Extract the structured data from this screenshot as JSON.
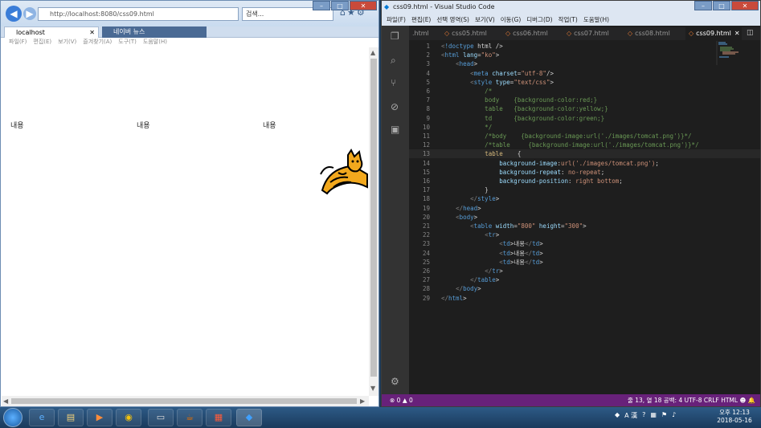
{
  "ie": {
    "address": "http://localhost:8080/css09.html",
    "search_placeholder": "검색...",
    "tab_active": "localhost",
    "tab_other": "네이버 뉴스",
    "menu": [
      "파일(F)",
      "편집(E)",
      "보기(V)",
      "즐겨찾기(A)",
      "도구(T)",
      "도움말(H)"
    ],
    "cells": [
      "내용",
      "내용",
      "내용"
    ]
  },
  "vscode": {
    "title": "css09.html - Visual Studio Code",
    "menu": [
      "파일(F)",
      "편집(E)",
      "선택 영역(S)",
      "보기(V)",
      "이동(G)",
      "디버그(D)",
      "작업(T)",
      "도움말(H)"
    ],
    "tabs": [
      ".html",
      "css05.html",
      "css06.html",
      "css07.html",
      "css08.html",
      "css09.html"
    ],
    "active_tab": "css09.html",
    "lines": [
      "<!doctype html />",
      "<html lang=\"ko\">",
      "    <head>",
      "        <meta charset=\"utf-8\"/>",
      "        <style type=\"text/css\">",
      "            /*",
      "            body    {background-color:red;}",
      "            table   {background-color:yellow;}",
      "            td      {background-color:green;}",
      "            */",
      "            /*body    {background-image:url('./images/tomcat.png')}*/",
      "            /*table     {background-image:url('./images/tomcat.png')}*/",
      "            table    {",
      "                background-image:url('./images/tomcat.png');",
      "                background-repeat: no-repeat;",
      "                background-position: right bottom;",
      "            }",
      "        </style>",
      "    </head>",
      "    <body>",
      "        <table width=\"800\" height=\"300\">",
      "            <tr>",
      "                <td>내용</td>",
      "                <td>내용</td>",
      "                <td>내용</td>",
      "            </tr>",
      "        </table>",
      "    </body>",
      "</html>"
    ],
    "status_left": "⊗ 0 ▲ 0",
    "status_right": "줄 13, 열 18   공백: 4   UTF-8   CRLF   HTML   ☻   🔔"
  },
  "taskbar": {
    "lang": "A 漢",
    "time": "오후 12:13",
    "date": "2018-05-16"
  },
  "colors": {
    "vscode_status": "#68217a",
    "ie_accent": "#3b7dd8",
    "html_tag": "#569cd6",
    "attribute": "#9cdcfe",
    "string": "#ce9178",
    "comment": "#6a9955"
  }
}
